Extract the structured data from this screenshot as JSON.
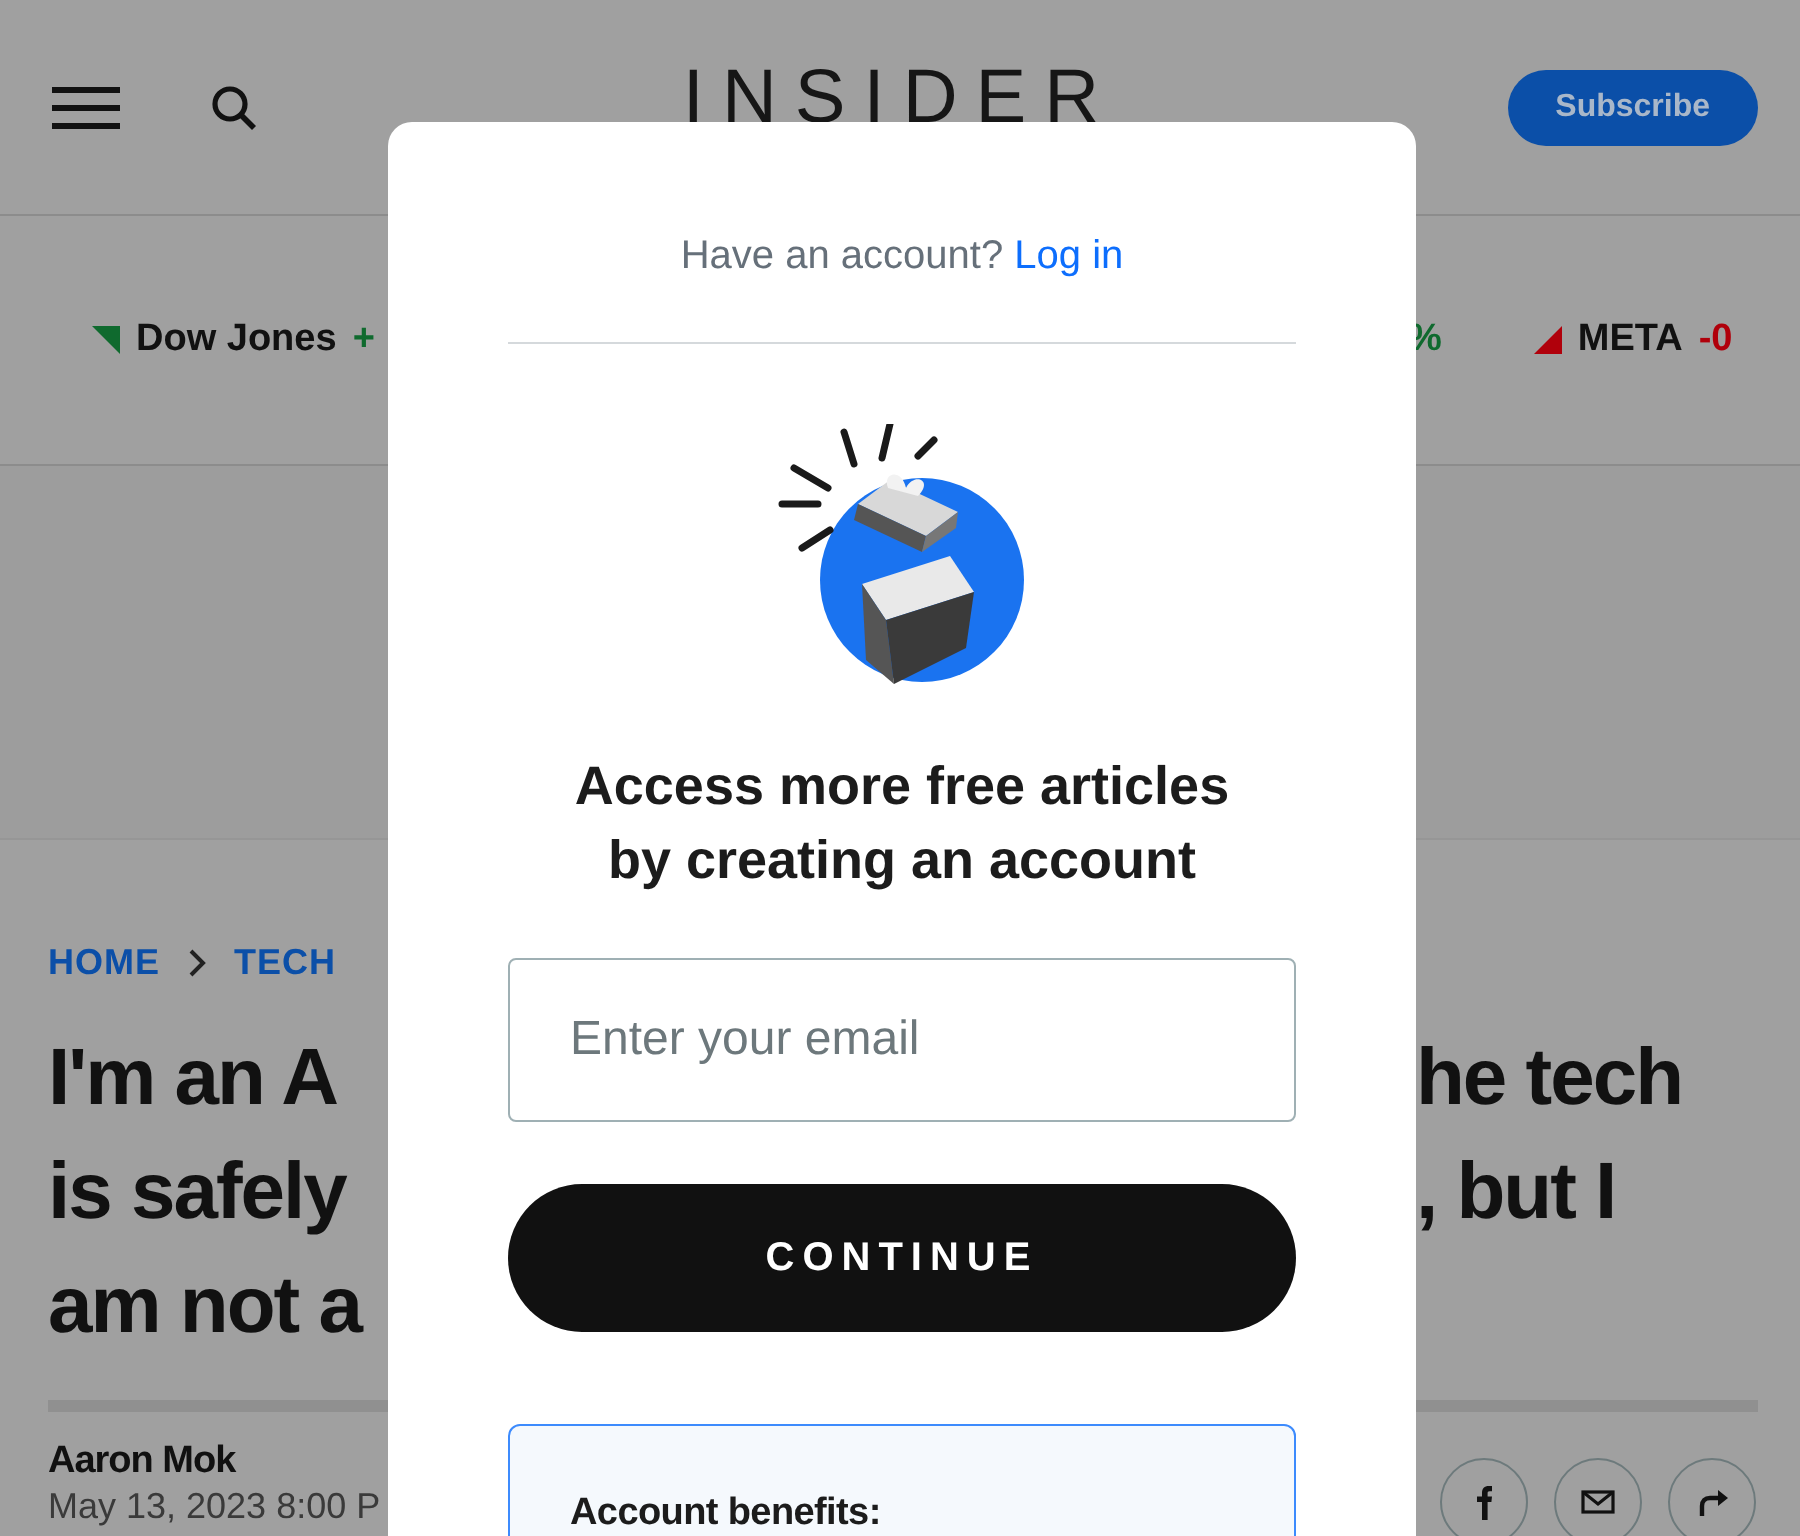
{
  "header": {
    "logo": "INSIDER",
    "subscribe": "Subscribe"
  },
  "ticker": {
    "left": [
      {
        "name": "Dow Jones",
        "change": "+",
        "color": "#0f6a2e"
      }
    ],
    "right": [
      {
        "change": "%",
        "color": "#0f6a2e"
      },
      {
        "name": "META",
        "change": "-0",
        "color": "#b0000b"
      }
    ]
  },
  "article": {
    "breadcrumb": [
      {
        "label": "HOME"
      },
      {
        "label": "TECH"
      }
    ],
    "headline_left": [
      "I'm an A",
      "is safely",
      "am not a"
    ],
    "headline_right": [
      "he tech",
      ", but I"
    ],
    "author": "Aaron Mok",
    "date": "May 13, 2023 8:00 P",
    "share": [
      {
        "kind": "facebook"
      },
      {
        "kind": "email"
      },
      {
        "kind": "share"
      }
    ]
  },
  "modal": {
    "prompt": "Have an account?",
    "login_link": "Log in",
    "heading": "Access more free articles by creating an account",
    "email": {
      "placeholder": "Enter your email"
    },
    "button": "CONTINUE",
    "benefits_title": "Account benefits:"
  }
}
